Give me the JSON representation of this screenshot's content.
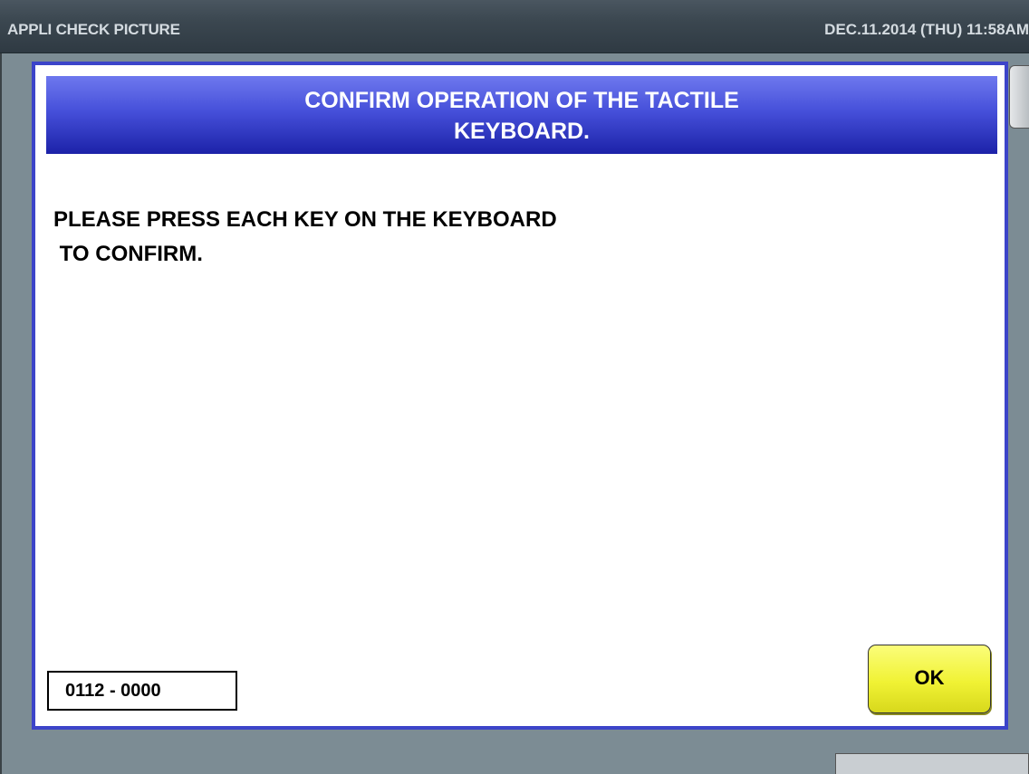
{
  "titlebar": {
    "app_title": "APPLI CHECK PICTURE",
    "datetime": "DEC.11.2014 (THU)  11:58AM"
  },
  "dialog": {
    "title_line1": "CONFIRM OPERATION OF THE TACTILE",
    "title_line2": "KEYBOARD.",
    "message": "PLEASE PRESS EACH KEY ON THE KEYBOARD\n TO CONFIRM.",
    "code": "0112 - 0000",
    "ok_label": "OK"
  },
  "colors": {
    "header_blue": "#3c44c9",
    "ok_yellow": "#f0f234",
    "background": "#7c8c94"
  }
}
